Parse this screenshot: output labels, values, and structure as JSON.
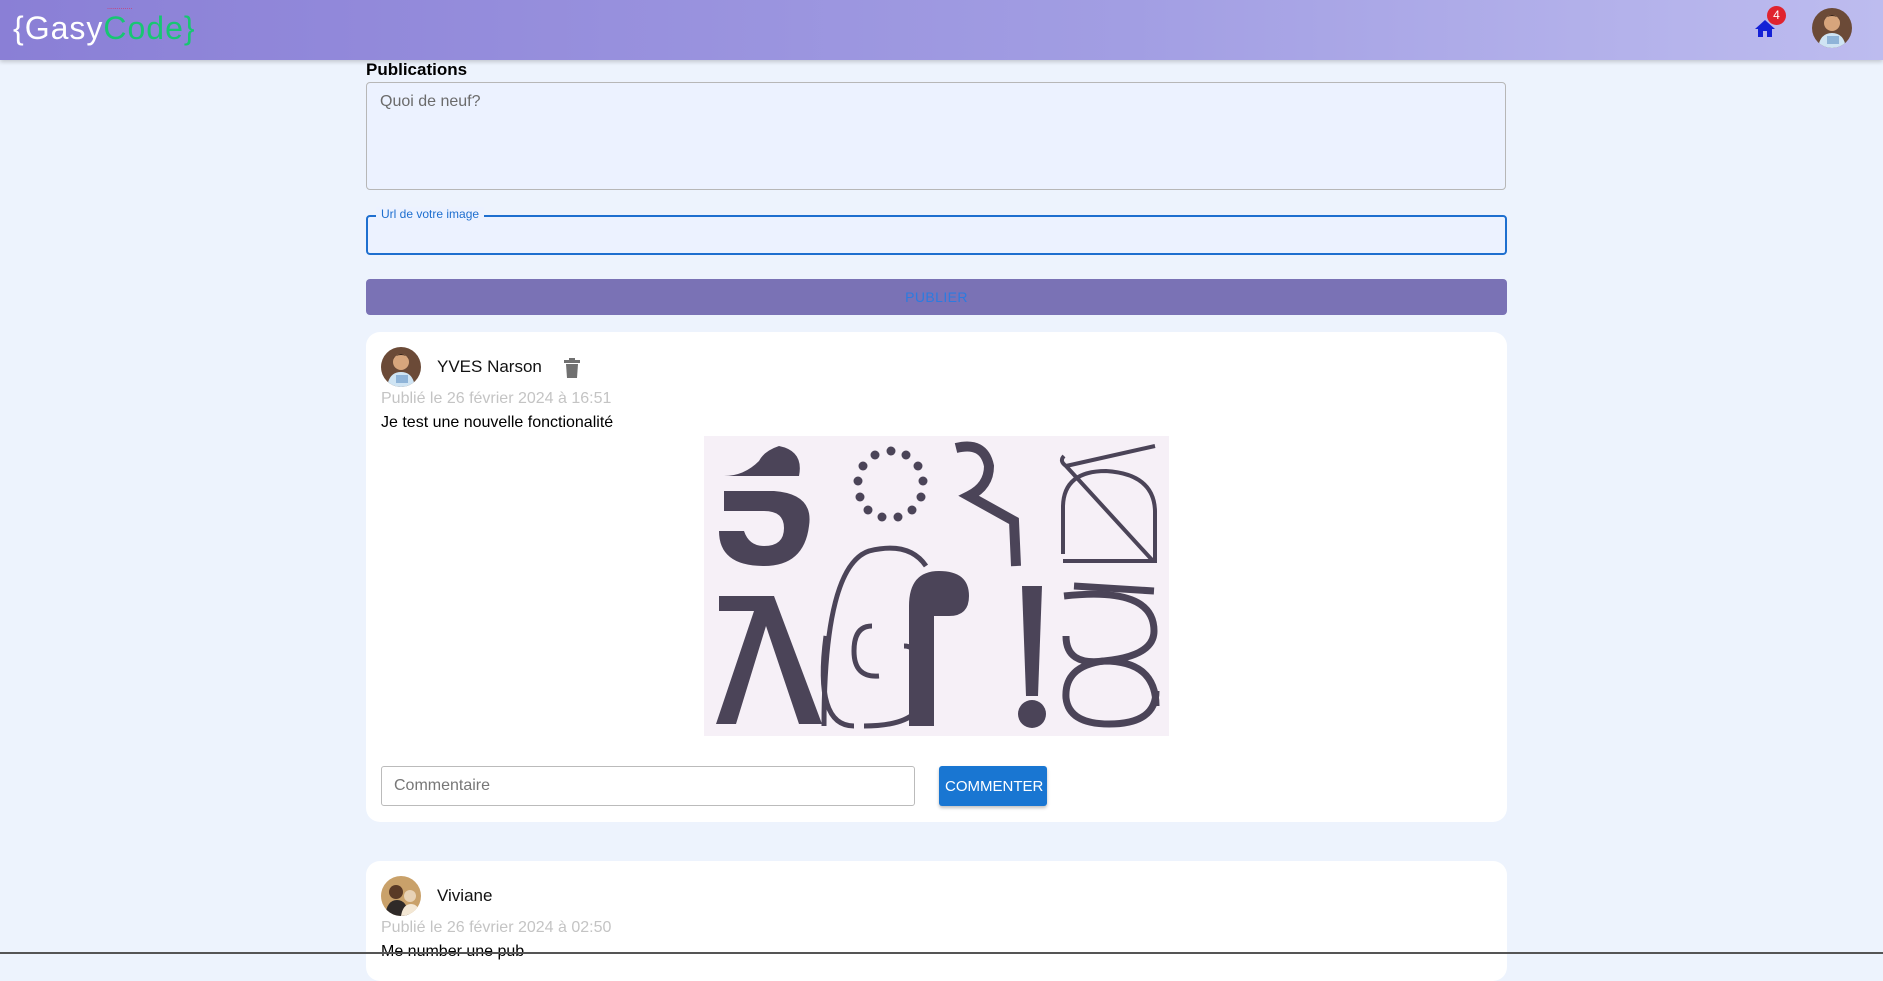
{
  "header": {
    "logo": {
      "open_brace": "{",
      "word_a": "Gasy",
      "word_b": "Code",
      "close_brace": "}",
      "tagline": "............."
    },
    "notification_count": "4",
    "home_icon": "home-icon",
    "colors": {
      "accent": "#8a7fd6",
      "logo_green": "#17c672",
      "badge": "#e0232e"
    }
  },
  "composer": {
    "title": "Publications",
    "text_placeholder": "Quoi de neuf?",
    "url_label": "Url de votre image",
    "url_value": "",
    "publish_label": "PUBLIER"
  },
  "posts": [
    {
      "author": "YVES Narson",
      "date": "Publié le 26 février 2024 à 16:51",
      "text": "Je test une nouvelle fonctionalité",
      "image_icon": "abstract-glyphs-image",
      "comment_placeholder": "Commentaire",
      "comment_button": "COMMENTER"
    },
    {
      "author": "Viviane",
      "date": "Publié le 26 février 2024 à 02:50",
      "text": "Me number une pub"
    }
  ]
}
